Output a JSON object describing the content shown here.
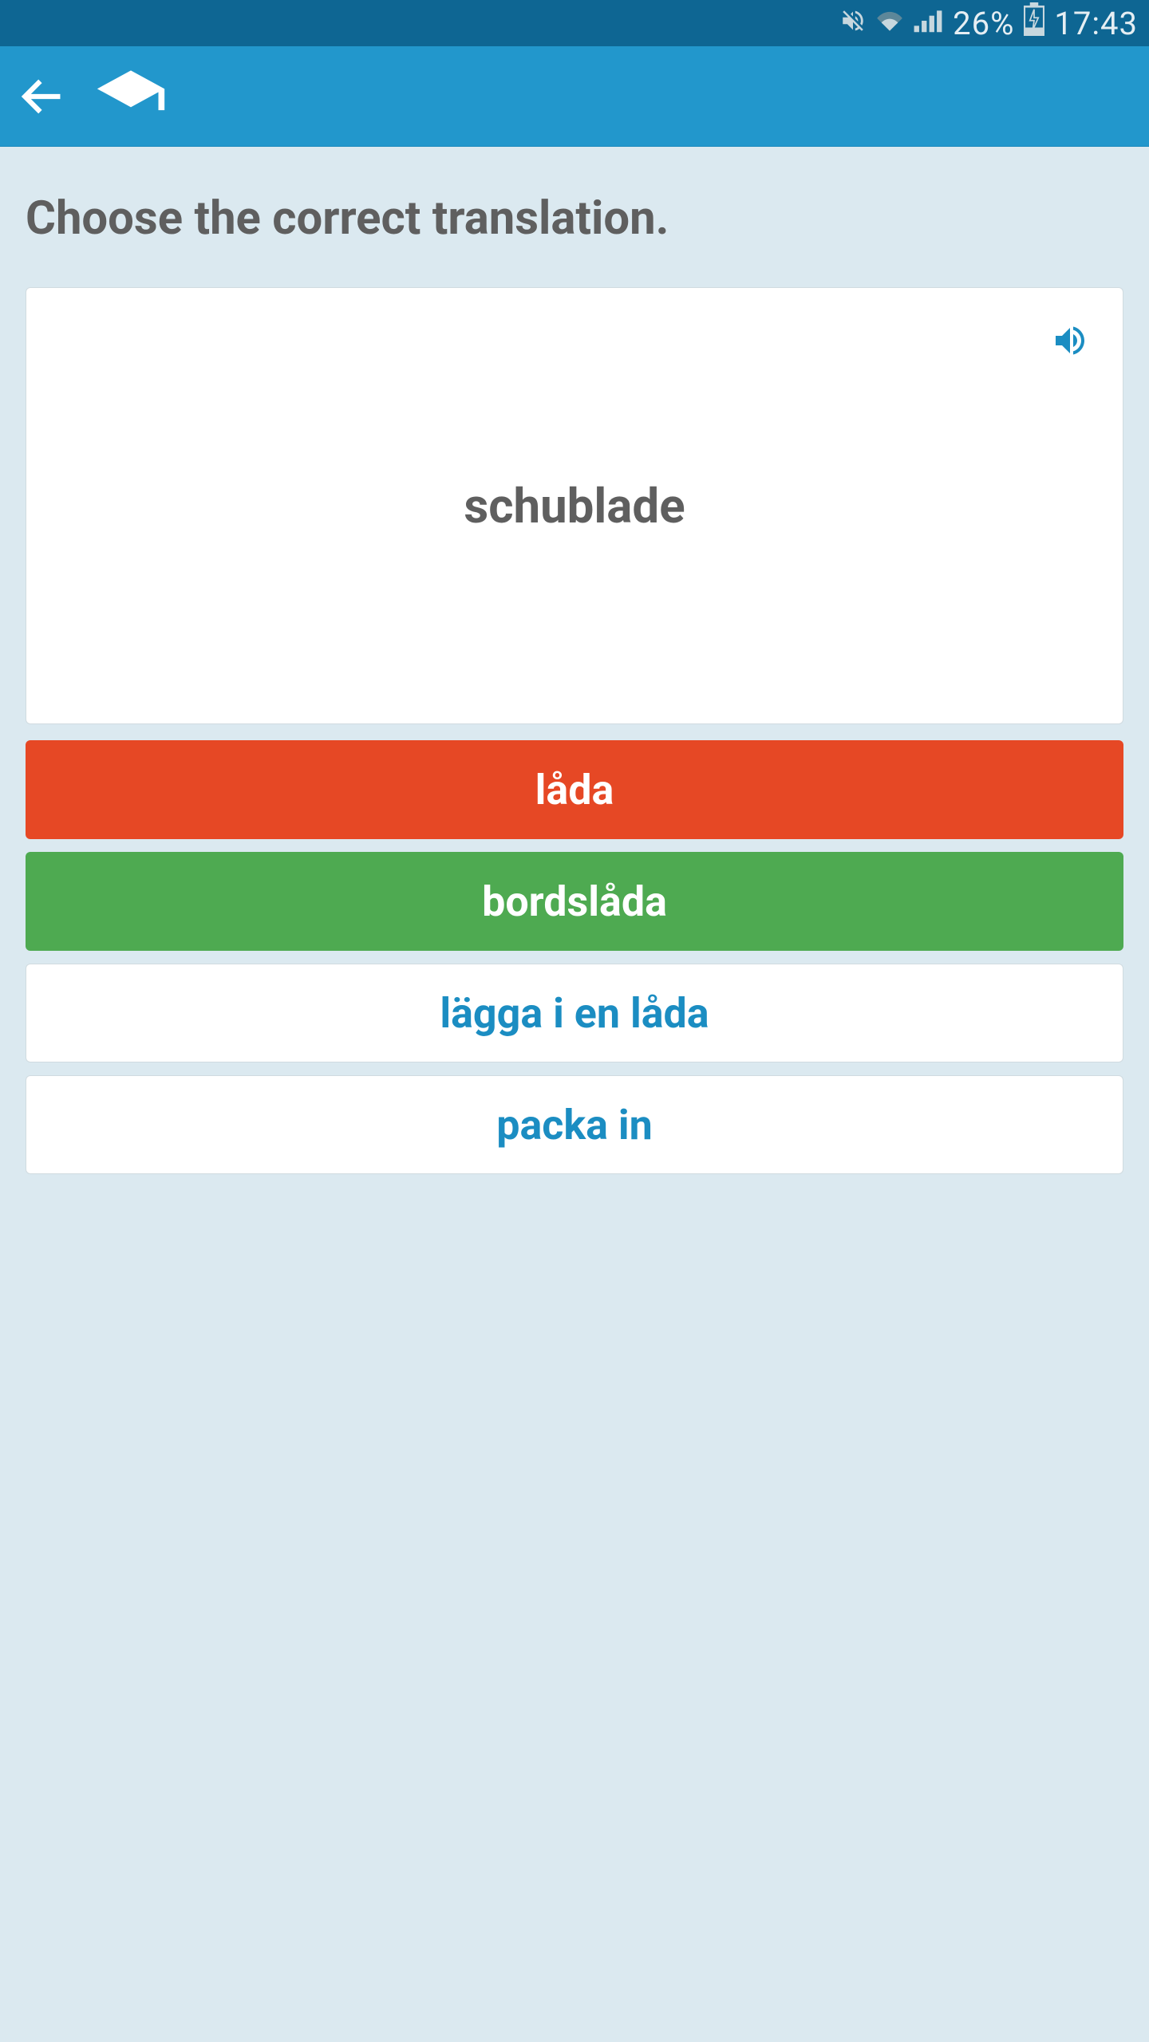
{
  "status_bar": {
    "battery_percent": "26%",
    "time": "17:43",
    "icons": {
      "mute": "mute-icon",
      "wifi": "wifi-icon",
      "cell": "cell-signal-icon",
      "battery": "battery-charging-icon"
    }
  },
  "header": {
    "back_icon": "arrow-left-icon",
    "app_icon": "graduation-cap-icon"
  },
  "prompt_text": "Choose the correct translation.",
  "card": {
    "word": "schublade",
    "sound_icon": "speaker-icon"
  },
  "answers": [
    {
      "label": "låda",
      "state": "incorrect"
    },
    {
      "label": "bordslåda",
      "state": "correct"
    },
    {
      "label": "lägga i en låda",
      "state": "neutral"
    },
    {
      "label": "packa in",
      "state": "neutral"
    }
  ],
  "colors": {
    "status_bar_bg": "#0e6693",
    "header_bg": "#2297cc",
    "page_bg": "#dbe9f0",
    "accent_blue": "#1b8dc2",
    "incorrect_red": "#e64825",
    "correct_green": "#4eaa51",
    "text_gray": "#5f5f5f"
  }
}
